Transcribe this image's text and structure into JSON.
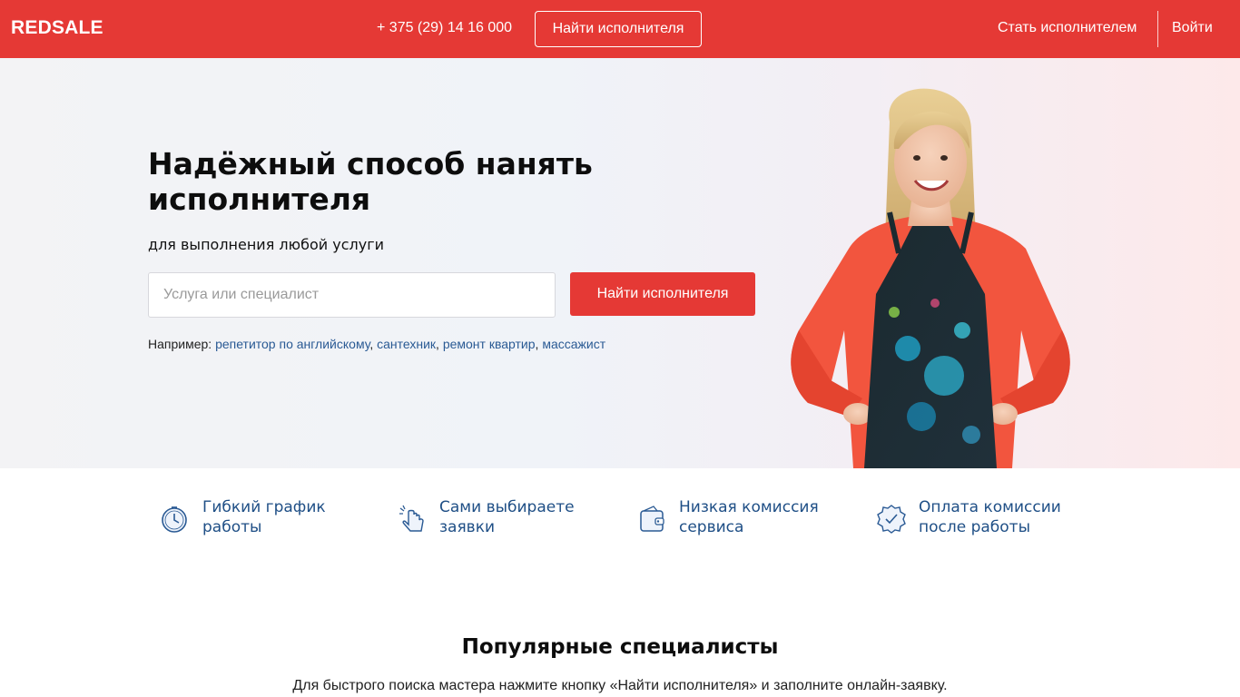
{
  "header": {
    "logo": "REDSALE",
    "phone": "+ 375 (29) 14 16 000",
    "find_button": "Найти исполнителя",
    "become_link": "Стать исполнителем",
    "login_link": "Войти"
  },
  "hero": {
    "title": "Надёжный способ нанять исполнителя",
    "subtitle": "для выполнения любой услуги",
    "search_placeholder": "Услуга или специалист",
    "search_value": "",
    "search_button": "Найти исполнителя",
    "examples_prefix": "Например:",
    "examples": [
      {
        "label": "репетитор по английскому",
        "sep": ", "
      },
      {
        "label": "сантехник",
        "sep": ", "
      },
      {
        "label": "ремонт квартир",
        "sep": ", "
      },
      {
        "label": "массажист",
        "sep": ""
      }
    ]
  },
  "features": [
    {
      "icon": "clock-icon",
      "label": "Гибкий график работы"
    },
    {
      "icon": "hand-pointer-icon",
      "label": "Сами выбираете заявки"
    },
    {
      "icon": "wallet-icon",
      "label": "Низкая комиссия сервиса"
    },
    {
      "icon": "check-badge-icon",
      "label": "Оплата комиссии после работы"
    }
  ],
  "popular": {
    "title": "Популярные специалисты",
    "description": "Для быстрого поиска мастера нажмите кнопку «Найти исполнителя» и заполните онлайн-заявку."
  },
  "colors": {
    "brand_red": "#e53935",
    "feature_blue": "#1f4f86",
    "link_blue": "#2a5a94"
  }
}
